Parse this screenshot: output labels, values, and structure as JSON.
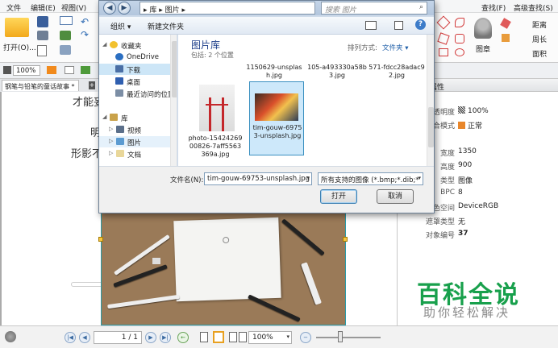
{
  "app": {
    "menu": [
      "文件",
      "编辑(E)",
      "视图(V)"
    ],
    "ribbon_open_label": "打开(O)...",
    "ribbon_right": {
      "find_label": "查找(F)",
      "adv_find_label": "高级查找(S)",
      "distance_label": "距离",
      "perimeter_label": "周长",
      "area_label": "面积",
      "stamp_label": "图章"
    },
    "zoom_top": "100%",
    "doc_tab": "钢笔与铅笔的童话故事 *",
    "doc_texts": [
      "才能妄",
      "明",
      "形影不"
    ],
    "properties": {
      "header": "属性",
      "rows": [
        {
          "label": "不透明度",
          "value": "100%"
        },
        {
          "label": "混合模式",
          "value": "正常"
        },
        {
          "label": "宽度",
          "value": "1350"
        },
        {
          "label": "高度",
          "value": "900"
        },
        {
          "label": "类型",
          "value": "图像"
        },
        {
          "label": "BPC",
          "value": "8"
        },
        {
          "label": "颜色空间",
          "value": "DeviceRGB"
        },
        {
          "label": "遮罩类型",
          "value": "无"
        },
        {
          "label": "对象编号",
          "value": "37"
        }
      ]
    },
    "watermark": {
      "title": "百科全说",
      "subtitle": "助你轻松解决"
    },
    "status": {
      "page_value": "1 / 1",
      "zoom_value": "100%"
    }
  },
  "dialog": {
    "address_path": "▸ 库 ▸ 图片 ▸",
    "search_placeholder": "搜索 图片",
    "toolbar": {
      "organize": "组织 ▾",
      "new_folder": "新建文件夹"
    },
    "nav": [
      {
        "label": "收藏夹",
        "type": "header"
      },
      {
        "label": "OneDrive",
        "type": "item"
      },
      {
        "label": "下载",
        "type": "item",
        "selected": true
      },
      {
        "label": "桌面",
        "type": "item"
      },
      {
        "label": "最近访问的位置",
        "type": "item"
      },
      {
        "label": "库",
        "type": "header"
      },
      {
        "label": "视频",
        "type": "item"
      },
      {
        "label": "图片",
        "type": "item"
      },
      {
        "label": "文档",
        "type": "item"
      }
    ],
    "library": {
      "title": "图片库",
      "subtitle": "包括: 2 个位置"
    },
    "sort": {
      "label": "排列方式:",
      "value": "文件夹 ▾"
    },
    "files_top": [
      "1150629-unsplash.jpg",
      "105-a493330a58b3.jpg",
      "571-fdcc28adac92.jpg"
    ],
    "files_main": [
      "photo-1542426900826-7aff5563369a.jpg",
      "tim-gouw-69753-unsplash.jpg"
    ],
    "filename_label": "文件名(N):",
    "filename_value": "tim-gouw-69753-unsplash.jpg",
    "filetype_value": "所有支持的图像 (*.bmp;*.dib;*",
    "open_button": "打开",
    "cancel_button": "取消"
  }
}
